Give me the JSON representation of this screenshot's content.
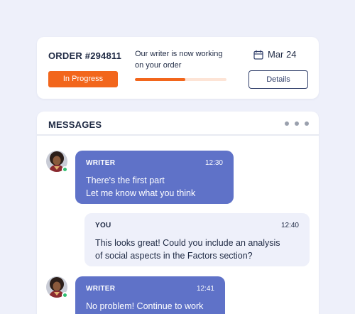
{
  "order": {
    "title": "ORDER #294811",
    "status_badge": "In Progress",
    "status_message": "Our writer is now working on your order",
    "progress": 0.55,
    "date": "Mar 24",
    "details_label": "Details",
    "calendar_icon": "calendar-icon"
  },
  "messages": {
    "title": "MESSAGES",
    "more_icon": "more-horizontal-icon",
    "items": [
      {
        "sender": "WRITER",
        "time": "12:30",
        "lines": [
          "There's the first part",
          "Let me know what you think"
        ]
      },
      {
        "sender": "YOU",
        "time": "12:40",
        "lines": [
          "This looks great! Could you include an analysis",
          "of social aspects in the Factors section?"
        ]
      },
      {
        "sender": "WRITER",
        "time": "12:41",
        "lines": [
          "No problem! Continue to work"
        ]
      }
    ]
  },
  "colors": {
    "accent": "#f2661c",
    "incoming_bubble": "#5f72c8",
    "outgoing_bubble": "#eef0fa",
    "online": "#2fbf71",
    "background": "#eef0fa"
  }
}
